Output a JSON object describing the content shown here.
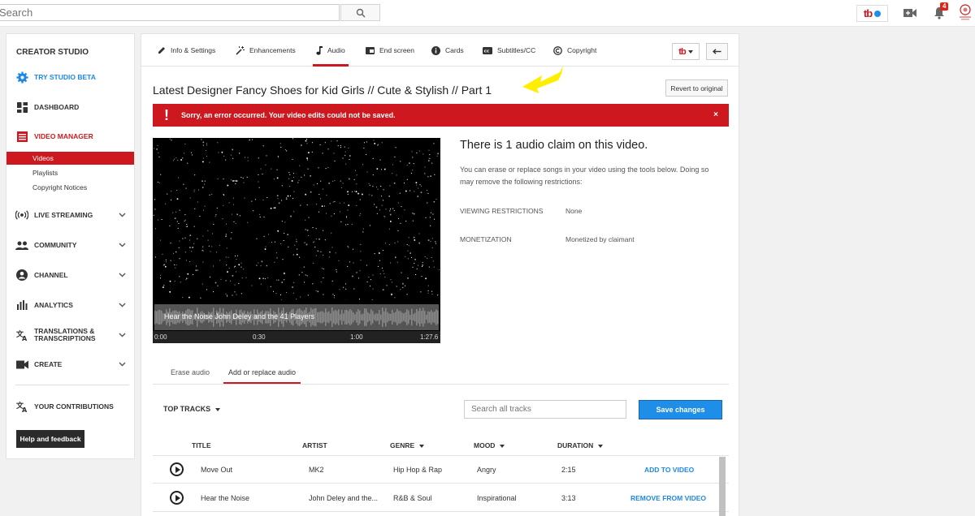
{
  "topbar": {
    "search_placeholder": "Search",
    "brand_text": "tb",
    "notifications_count": "4"
  },
  "sidebar": {
    "title": "CREATOR STUDIO",
    "try_beta": "TRY STUDIO BETA",
    "dashboard": "DASHBOARD",
    "video_manager": "VIDEO MANAGER",
    "sub_items": [
      "Videos",
      "Playlists",
      "Copyright Notices"
    ],
    "live_streaming": "LIVE STREAMING",
    "community": "COMMUNITY",
    "channel": "CHANNEL",
    "analytics": "ANALYTICS",
    "translations_line1": "TRANSLATIONS &",
    "translations_line2": "TRANSCRIPTIONS",
    "create": "CREATE",
    "contributions": "YOUR CONTRIBUTIONS",
    "help": "Help and feedback"
  },
  "tabs": [
    "Info & Settings",
    "Enhancements",
    "Audio",
    "End screen",
    "Cards",
    "Subtitles/CC",
    "Copyright"
  ],
  "active_tab": "Audio",
  "video": {
    "title": "Latest Designer Fancy Shoes for Kid Girls // Cute & Stylish // Part 1",
    "revert_label": "Revert to original",
    "error_message": "Sorry, an error occurred. Your video edits could not be saved.",
    "error_close": "×"
  },
  "player": {
    "track_label": "Hear the Noise John Deley and the 41 Players",
    "times": [
      "0:00",
      "0:30",
      "1:00",
      "1:27.6"
    ]
  },
  "claim": {
    "title": "There is 1 audio claim on this video.",
    "description": "You can erase or replace songs in your video using the tools below. Doing so may remove the following restrictions:",
    "viewing_label": "VIEWING RESTRICTIONS",
    "viewing_value": "None",
    "monetization_label": "MONETIZATION",
    "monetization_value": "Monetized by claimant"
  },
  "audio_tabs": {
    "erase": "Erase audio",
    "add": "Add or replace audio"
  },
  "tracks": {
    "filter_label": "TOP TRACKS",
    "search_placeholder": "Search all tracks",
    "save_label": "Save changes",
    "headers": [
      "TITLE",
      "ARTIST",
      "GENRE",
      "MOOD",
      "DURATION"
    ],
    "rows": [
      {
        "title": "Move Out",
        "artist": "MK2",
        "genre": "Hip Hop & Rap",
        "mood": "Angry",
        "duration": "2:15",
        "action": "ADD TO VIDEO"
      },
      {
        "title": "Hear the Noise",
        "artist": "John Deley and the...",
        "genre": "R&B & Soul",
        "mood": "Inspirational",
        "duration": "3:13",
        "action": "REMOVE FROM VIDEO"
      }
    ]
  },
  "colors": {
    "accent_red": "#cc181e",
    "link_blue": "#1e88e5",
    "save_blue": "#1e8ee8",
    "highlight_yellow": "#ffee00"
  }
}
